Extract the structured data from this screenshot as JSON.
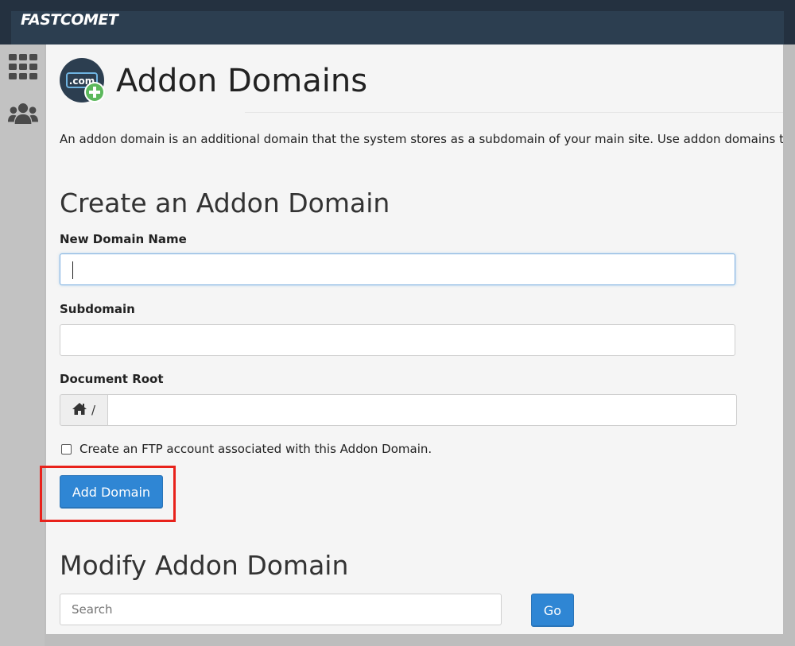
{
  "brand": {
    "logo_text": "FASTCOMET"
  },
  "sidebar": {
    "items": [
      {
        "icon": "grid-icon"
      },
      {
        "icon": "users-icon"
      }
    ]
  },
  "page": {
    "title": "Addon Domains",
    "icon_text": ".com",
    "description": "An addon domain is an additional domain that the system stores as a subdomain of your main site. Use addon domains to host additional domains on your account."
  },
  "create_section": {
    "title": "Create an Addon Domain",
    "new_domain_label": "New Domain Name",
    "new_domain_value": "",
    "subdomain_label": "Subdomain",
    "subdomain_value": "",
    "document_root_label": "Document Root",
    "document_root_prefix": "/",
    "document_root_value": "",
    "ftp_checkbox_label": "Create an FTP account associated with this Addon Domain.",
    "ftp_checkbox_checked": false,
    "add_button_label": "Add Domain"
  },
  "modify_section": {
    "title": "Modify Addon Domain",
    "search_placeholder": "Search",
    "go_button_label": "Go"
  },
  "colors": {
    "accent": "#2f86d4",
    "topbar": "#243140",
    "highlight": "#e8221b",
    "icon_badge": "#5cb85c"
  }
}
